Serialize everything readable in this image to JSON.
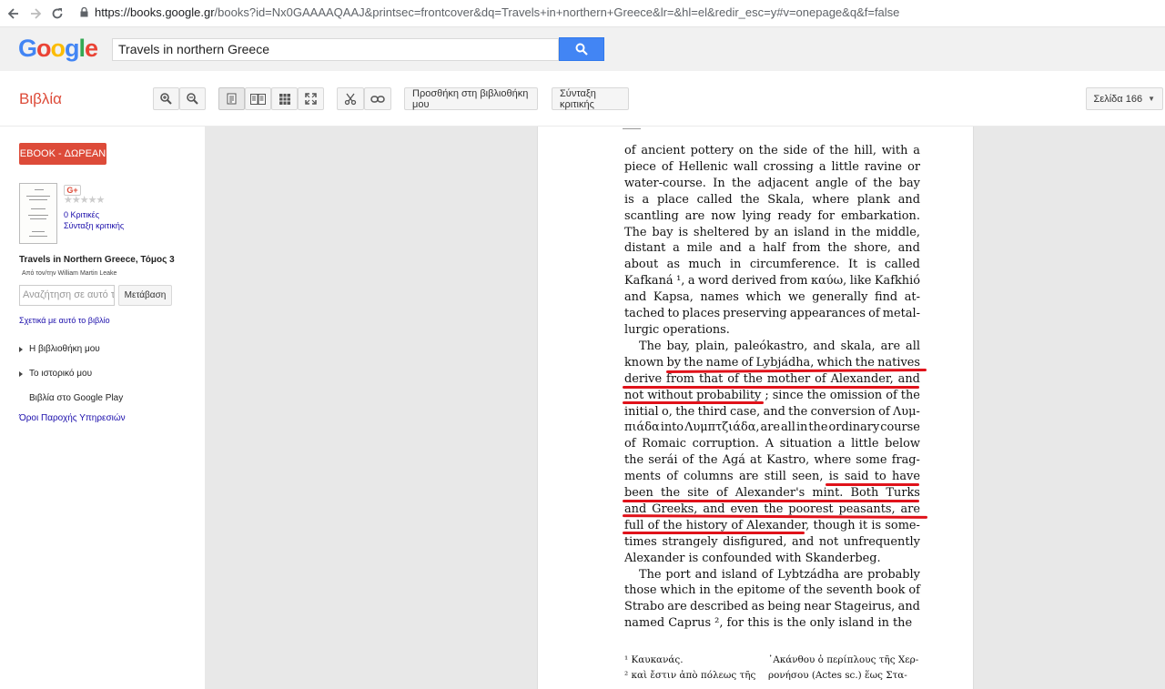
{
  "browser": {
    "url_host": "https://books.google.gr",
    "url_path": "/books?id=Nx0GAAAAQAAJ&printsec=frontcover&dq=Travels+in+northern+Greece&lr=&hl=el&redir_esc=y#v=onepage&q&f=false"
  },
  "header": {
    "logo": "Google",
    "logo_colors": [
      "#4285f4",
      "#ea4335",
      "#fbbc05",
      "#4285f4",
      "#34a853",
      "#ea4335"
    ],
    "search_value": "Travels in northern Greece"
  },
  "toolbar": {
    "section_title": "Βιβλία",
    "add_to_library": "Προσθήκη στη βιβλιοθήκη μου",
    "write_review": "Σύνταξη κριτικής",
    "page_selector": "Σελίδα 166"
  },
  "sidebar": {
    "ebook_label": "EBOOK - ΔΩΡΕΑΝ",
    "gplus": "G+",
    "reviews_count": "0 Κριτικές",
    "write_review": "Σύνταξη κριτικής",
    "book_title": "Travels in Northern Greece, Τόμος 3",
    "author": "Από τον/την William Martin Leake",
    "search_placeholder": "Αναζήτηση σε αυτό το βιβλίο",
    "go_button": "Μετάβαση",
    "about_link": "Σχετικά με αυτό το βιβλίο",
    "my_library": "Η βιβλιοθήκη μου",
    "my_history": "Το ιστορικό μου",
    "play_books": "Βιβλία στο Google Play",
    "terms": "Όροι Παροχής Υπηρεσιών"
  },
  "page": {
    "lines": [
      "of ancient pottery on the side of the hill, with a",
      "piece of Hellenic wall crossing a little ravine or",
      "water-course.  In the adjacent angle of the bay",
      "is a place called the Skala, where plank and",
      "scantling are now lying ready for embarkation.",
      "The bay is sheltered by an island in the middle,",
      "distant a mile and a half from the shore, and",
      "about as much in circumference.   It is called",
      "Kafkaná ¹, a word derived from καύω, like Kafkhió",
      "and Kapsa, names which we generally find at-",
      "tached to places preserving appearances of metal-",
      "lurgic operations.",
      "The bay, plain, paleókastro, and skala, are all",
      "known by the name of Lybjádha, which the natives",
      "derive from that of the mother of Alexander, and",
      "not without probability ; since the omission of the",
      "initial o, the third case, and the conversion of Λυμ-",
      "πιάδα into Λυμπτζιάδα, are all in the ordinary course",
      "of Romaic corruption.   A situation a little below",
      "the serái of the Agá at Kastro, where some frag-",
      "ments of columns are still seen, is said to have",
      "been the site of Alexander's mint.  Both Turks",
      "and Greeks, and even the poorest peasants, are",
      "full of the history of Alexander, though it is some-",
      "times strangely disfigured, and not unfrequently",
      "Alexander is confounded with Skanderbeg.",
      "The port and island of Lybtzádha are probably",
      "those which in the epitome of the seventh book of",
      "Strabo are described as being near Stageirus, and",
      "named Caprus ², for this is the only island in the"
    ],
    "footnotes": [
      {
        "left": "¹ Καυκανάς.",
        "right": "᾿Ακάνθου ὁ περίπλους τῆς Χερ-"
      },
      {
        "left": "² καὶ ἔστιν ἀπὸ πόλεως τῆς",
        "right": "ρονήσου (Actes sc.) ἕως Στα-"
      }
    ]
  }
}
